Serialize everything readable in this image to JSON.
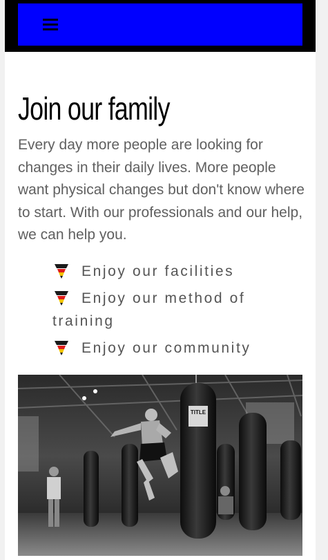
{
  "nav": {
    "menu_icon": "hamburger-menu-icon",
    "bar_color": "#0000ff",
    "frame_color": "#000000"
  },
  "main": {
    "title": "Join our family",
    "intro": "Every day more people are looking for changes in their daily lives. More people want physical changes but don't know where to start. With our professionals and our help, we can help you.",
    "features": [
      {
        "icon": "kettlebell-icon",
        "label": "Enjoy our facilities"
      },
      {
        "icon": "kettlebell-icon",
        "label": "Enjoy our method of training"
      },
      {
        "icon": "kettlebell-icon",
        "label": "Enjoy our community"
      }
    ],
    "photo": {
      "subject": "kickboxing-gym-photo",
      "bag_brand": "TITLE"
    }
  }
}
